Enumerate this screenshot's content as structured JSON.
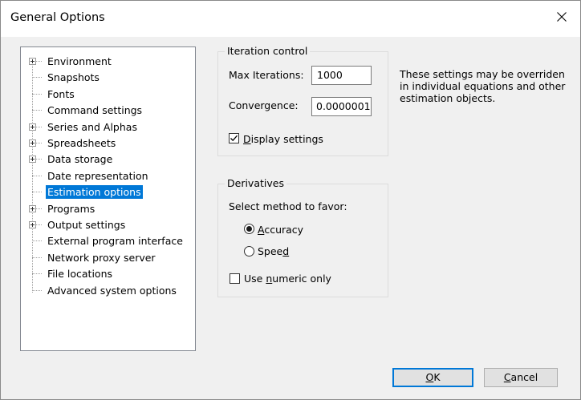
{
  "window": {
    "title": "General Options"
  },
  "tree": {
    "items": [
      {
        "label": "Environment",
        "expandable": true
      },
      {
        "label": "Snapshots",
        "expandable": false
      },
      {
        "label": "Fonts",
        "expandable": false
      },
      {
        "label": "Command settings",
        "expandable": false
      },
      {
        "label": "Series and Alphas",
        "expandable": true
      },
      {
        "label": "Spreadsheets",
        "expandable": true
      },
      {
        "label": "Data storage",
        "expandable": true
      },
      {
        "label": "Date representation",
        "expandable": false
      },
      {
        "label": "Estimation options",
        "expandable": false,
        "selected": true
      },
      {
        "label": "Programs",
        "expandable": true
      },
      {
        "label": "Output settings",
        "expandable": true
      },
      {
        "label": "External program interface",
        "expandable": false
      },
      {
        "label": "Network proxy server",
        "expandable": false
      },
      {
        "label": "File locations",
        "expandable": false
      },
      {
        "label": "Advanced system options",
        "expandable": false
      }
    ]
  },
  "iteration": {
    "title": "Iteration control",
    "max_label": "Max Iterations:",
    "max_value": "1000",
    "conv_label": "Convergence:",
    "conv_value": "0.0000001",
    "display_pre": "",
    "display_mn": "D",
    "display_post": "isplay settings",
    "display_checked": true
  },
  "note": "These settings may be overriden in individual equations and other estimation objects.",
  "derivatives": {
    "title": "Derivatives",
    "method_label": "Select method to favor:",
    "accuracy_pre": "",
    "accuracy_mn": "A",
    "accuracy_post": "ccuracy",
    "accuracy_selected": true,
    "speed_pre": "Spee",
    "speed_mn": "d",
    "speed_post": "",
    "numeric_pre": "Use ",
    "numeric_mn": "n",
    "numeric_post": "umeric only",
    "numeric_checked": false
  },
  "buttons": {
    "ok_pre": "",
    "ok_mn": "O",
    "ok_post": "K",
    "cancel_pre": "",
    "cancel_mn": "C",
    "cancel_post": "ancel"
  },
  "icons": {
    "close": "close-icon",
    "checkmark": "checkmark-icon",
    "expand": "plus-expander-icon"
  },
  "colors": {
    "selection": "#0078d7",
    "dialog_bg": "#f0f0f0",
    "title_bg": "#ffffff"
  }
}
